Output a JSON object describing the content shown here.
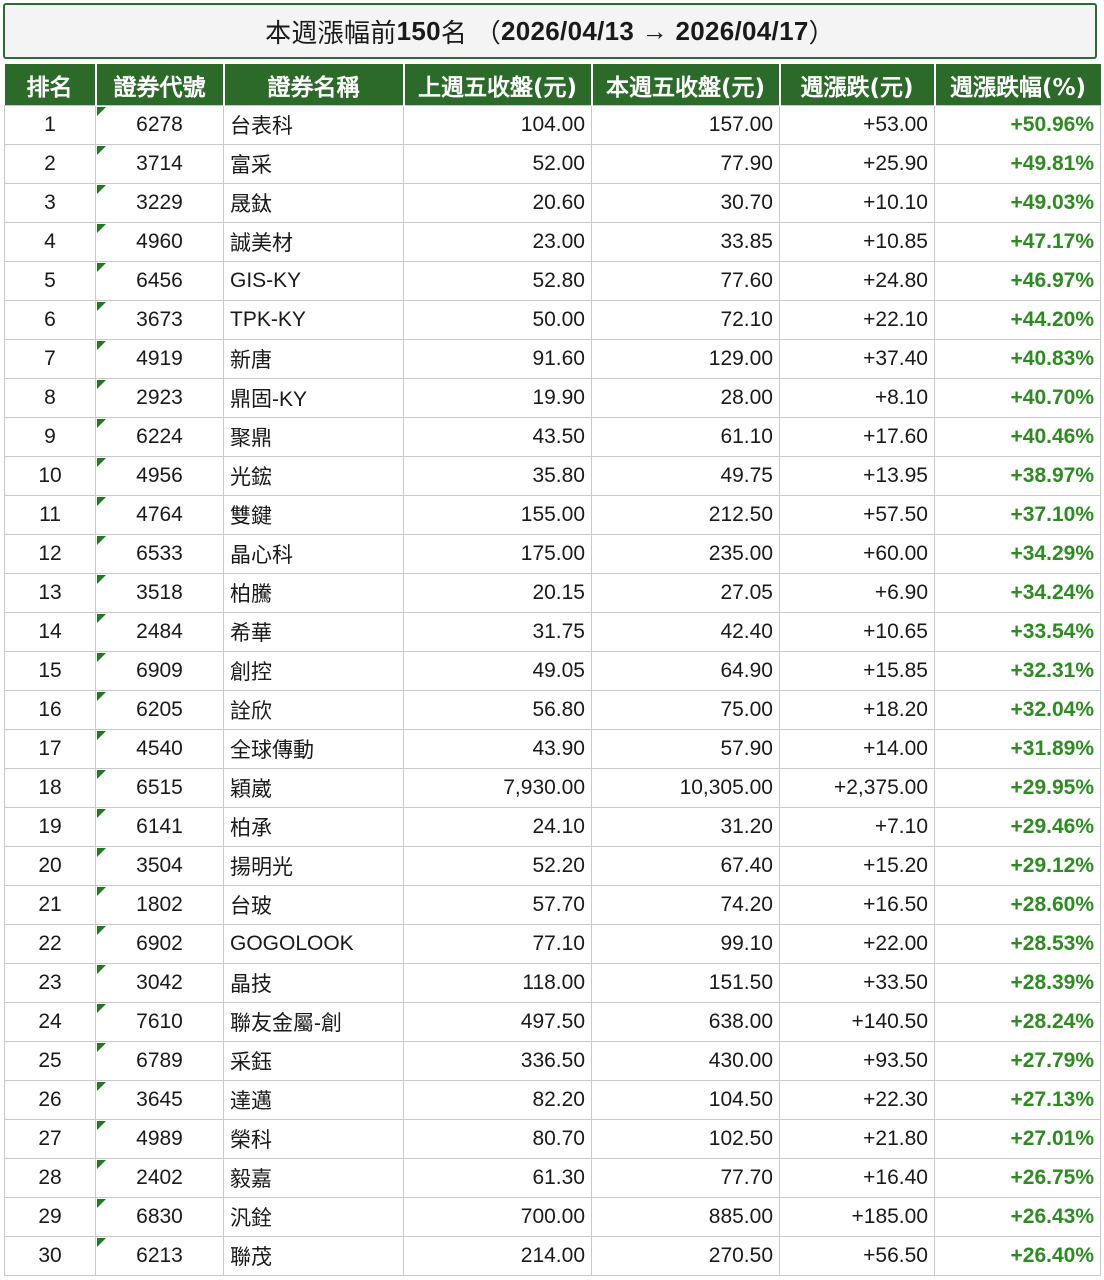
{
  "title": {
    "prefix": "本週漲幅前",
    "count": "150",
    "suffix": "名 （",
    "range": "2026/04/13 → 2026/04/17",
    "close": "）"
  },
  "columns": [
    "排名",
    "證券代號",
    "證券名稱",
    "上週五收盤(元)",
    "本週五收盤(元)",
    "週漲跌(元)",
    "週漲跌幅(%)"
  ],
  "colors": {
    "header_bg": "#2c6a2a",
    "percent_text": "#2e8b22",
    "flag": "#1f7a1f"
  },
  "rows": [
    [
      "1",
      "6278",
      "台表科",
      "104.00",
      "157.00",
      "+53.00",
      "+50.96%"
    ],
    [
      "2",
      "3714",
      "富采",
      "52.00",
      "77.90",
      "+25.90",
      "+49.81%"
    ],
    [
      "3",
      "3229",
      "晟鈦",
      "20.60",
      "30.70",
      "+10.10",
      "+49.03%"
    ],
    [
      "4",
      "4960",
      "誠美材",
      "23.00",
      "33.85",
      "+10.85",
      "+47.17%"
    ],
    [
      "5",
      "6456",
      "GIS-KY",
      "52.80",
      "77.60",
      "+24.80",
      "+46.97%"
    ],
    [
      "6",
      "3673",
      "TPK-KY",
      "50.00",
      "72.10",
      "+22.10",
      "+44.20%"
    ],
    [
      "7",
      "4919",
      "新唐",
      "91.60",
      "129.00",
      "+37.40",
      "+40.83%"
    ],
    [
      "8",
      "2923",
      "鼎固-KY",
      "19.90",
      "28.00",
      "+8.10",
      "+40.70%"
    ],
    [
      "9",
      "6224",
      "聚鼎",
      "43.50",
      "61.10",
      "+17.60",
      "+40.46%"
    ],
    [
      "10",
      "4956",
      "光鋐",
      "35.80",
      "49.75",
      "+13.95",
      "+38.97%"
    ],
    [
      "11",
      "4764",
      "雙鍵",
      "155.00",
      "212.50",
      "+57.50",
      "+37.10%"
    ],
    [
      "12",
      "6533",
      "晶心科",
      "175.00",
      "235.00",
      "+60.00",
      "+34.29%"
    ],
    [
      "13",
      "3518",
      "柏騰",
      "20.15",
      "27.05",
      "+6.90",
      "+34.24%"
    ],
    [
      "14",
      "2484",
      "希華",
      "31.75",
      "42.40",
      "+10.65",
      "+33.54%"
    ],
    [
      "15",
      "6909",
      "創控",
      "49.05",
      "64.90",
      "+15.85",
      "+32.31%"
    ],
    [
      "16",
      "6205",
      "詮欣",
      "56.80",
      "75.00",
      "+18.20",
      "+32.04%"
    ],
    [
      "17",
      "4540",
      "全球傳動",
      "43.90",
      "57.90",
      "+14.00",
      "+31.89%"
    ],
    [
      "18",
      "6515",
      "穎崴",
      "7,930.00",
      "10,305.00",
      "+2,375.00",
      "+29.95%"
    ],
    [
      "19",
      "6141",
      "柏承",
      "24.10",
      "31.20",
      "+7.10",
      "+29.46%"
    ],
    [
      "20",
      "3504",
      "揚明光",
      "52.20",
      "67.40",
      "+15.20",
      "+29.12%"
    ],
    [
      "21",
      "1802",
      "台玻",
      "57.70",
      "74.20",
      "+16.50",
      "+28.60%"
    ],
    [
      "22",
      "6902",
      "GOGOLOOK",
      "77.10",
      "99.10",
      "+22.00",
      "+28.53%"
    ],
    [
      "23",
      "3042",
      "晶技",
      "118.00",
      "151.50",
      "+33.50",
      "+28.39%"
    ],
    [
      "24",
      "7610",
      "聯友金屬-創",
      "497.50",
      "638.00",
      "+140.50",
      "+28.24%"
    ],
    [
      "25",
      "6789",
      "采鈺",
      "336.50",
      "430.00",
      "+93.50",
      "+27.79%"
    ],
    [
      "26",
      "3645",
      "達邁",
      "82.20",
      "104.50",
      "+22.30",
      "+27.13%"
    ],
    [
      "27",
      "4989",
      "榮科",
      "80.70",
      "102.50",
      "+21.80",
      "+27.01%"
    ],
    [
      "28",
      "2402",
      "毅嘉",
      "61.30",
      "77.70",
      "+16.40",
      "+26.75%"
    ],
    [
      "29",
      "6830",
      "汎銓",
      "700.00",
      "885.00",
      "+185.00",
      "+26.43%"
    ],
    [
      "30",
      "6213",
      "聯茂",
      "214.00",
      "270.50",
      "+56.50",
      "+26.40%"
    ]
  ]
}
